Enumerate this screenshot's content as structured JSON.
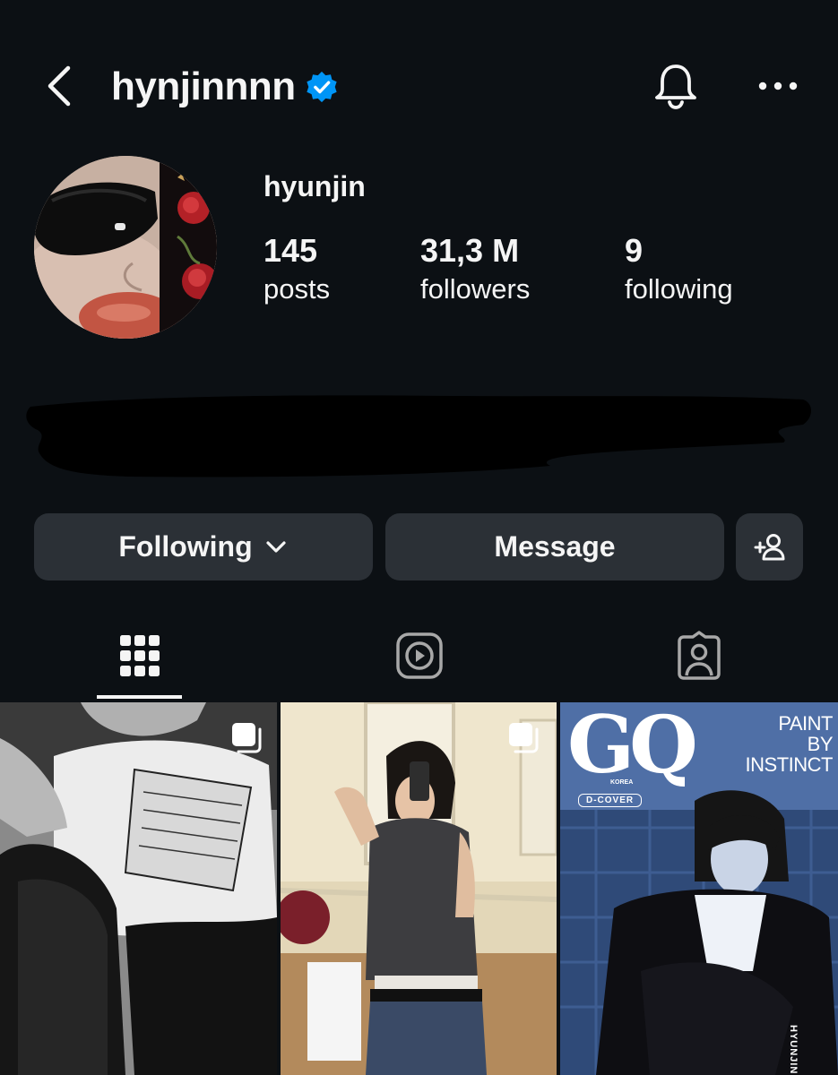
{
  "header": {
    "handle": "hynjinnnn",
    "icons": {
      "back": "chevron-left-icon",
      "verified": "verified-badge-icon",
      "notifications": "bell-icon",
      "more": "more-horizontal-icon"
    }
  },
  "profile": {
    "name": "hyunjin",
    "stats": [
      {
        "value": "145",
        "label": "posts"
      },
      {
        "value": "31,3 M",
        "label": "followers"
      },
      {
        "value": "9",
        "label": "following"
      }
    ]
  },
  "actions": {
    "following_label": "Following",
    "message_label": "Message",
    "add_user_icon": "add-person-icon"
  },
  "tabs": [
    {
      "icon": "grid-icon",
      "active": true
    },
    {
      "icon": "reels-icon",
      "active": false
    },
    {
      "icon": "tagged-icon",
      "active": false
    }
  ],
  "posts": [
    {
      "multiple": true
    },
    {
      "multiple": true
    },
    {
      "multiple": false,
      "cover_logo": "GQ",
      "cover_country": "KOREA",
      "cover_label": "D-COVER",
      "cover_headline": [
        "PAINT",
        "BY",
        "INSTINCT"
      ],
      "cover_side_text": "HYUNJIN"
    }
  ],
  "colors": {
    "background": "#0c1014",
    "button": "#2b3036",
    "text": "#f5f5f5",
    "verified": "#0095f6"
  }
}
